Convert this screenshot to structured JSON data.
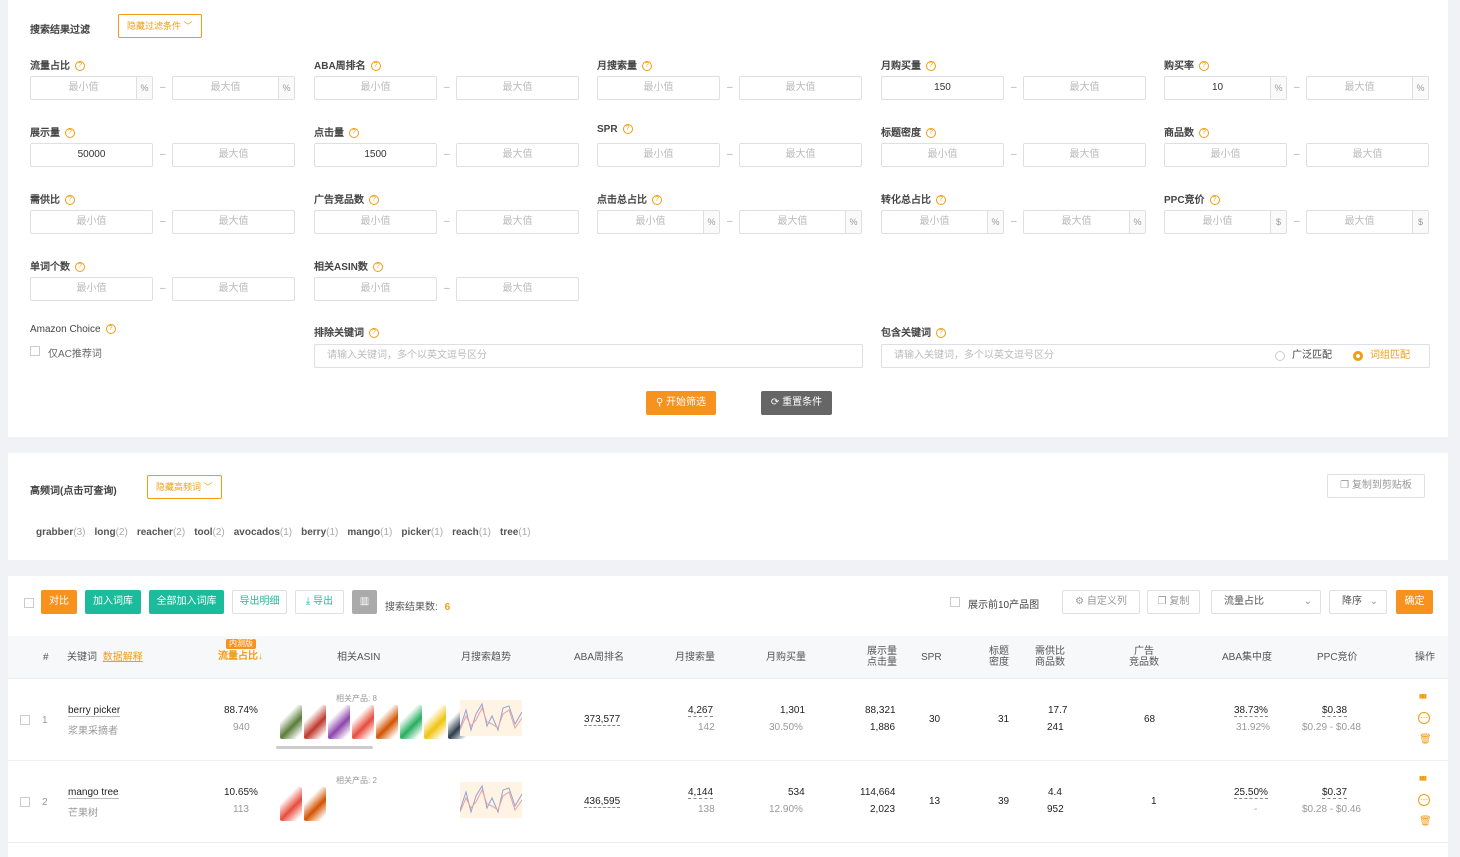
{
  "filter": {
    "title": "搜索结果过滤",
    "hide_btn": "隐藏过滤条件 ﹀",
    "min": "最小值",
    "max": "最大值",
    "fields": [
      {
        "label": "流量占比",
        "min": "",
        "max": "",
        "unit": "%"
      },
      {
        "label": "ABA周排名",
        "min": "",
        "max": "",
        "unit": ""
      },
      {
        "label": "月搜索量",
        "min": "",
        "max": "",
        "unit": ""
      },
      {
        "label": "月购买量",
        "min": "150",
        "max": "",
        "unit": ""
      },
      {
        "label": "购买率",
        "min": "10",
        "max": "",
        "unit": "%"
      },
      {
        "label": "展示量",
        "min": "50000",
        "max": "",
        "unit": ""
      },
      {
        "label": "点击量",
        "min": "1500",
        "max": "",
        "unit": ""
      },
      {
        "label": "SPR",
        "min": "",
        "max": "",
        "unit": ""
      },
      {
        "label": "标题密度",
        "min": "",
        "max": "",
        "unit": ""
      },
      {
        "label": "商品数",
        "min": "",
        "max": "",
        "unit": ""
      },
      {
        "label": "需供比",
        "min": "",
        "max": "",
        "unit": ""
      },
      {
        "label": "广告竞品数",
        "min": "",
        "max": "",
        "unit": ""
      },
      {
        "label": "点击总占比",
        "min": "",
        "max": "",
        "unit": "%"
      },
      {
        "label": "转化总占比",
        "min": "",
        "max": "",
        "unit": "%"
      },
      {
        "label": "PPC竞价",
        "min": "",
        "max": "",
        "unit": "$"
      },
      {
        "label": "单词个数",
        "min": "",
        "max": "",
        "unit": ""
      },
      {
        "label": "相关ASIN数",
        "min": "",
        "max": "",
        "unit": ""
      }
    ],
    "amazon_choice": "Amazon Choice",
    "ac_only": "仅AC推荐词",
    "exclude_label": "排除关键词",
    "exclude_placeholder": "请输入关键词，多个以英文逗号区分",
    "include_label": "包含关键词",
    "include_placeholder": "请输入关键词，多个以英文逗号区分",
    "broad_match": "广泛匹配",
    "phrase_match": "词组匹配",
    "start_btn": "开始筛选",
    "reset_btn": "重置条件"
  },
  "hf": {
    "title": "高频词(点击可查询)",
    "hide_btn": "隐藏高频词 ﹀",
    "copy_btn": "复制到剪贴板",
    "words": [
      {
        "w": "grabber",
        "n": "(3)"
      },
      {
        "w": "long",
        "n": "(2)"
      },
      {
        "w": "reacher",
        "n": "(2)"
      },
      {
        "w": "tool",
        "n": "(2)"
      },
      {
        "w": "avocados",
        "n": "(1)"
      },
      {
        "w": "berry",
        "n": "(1)"
      },
      {
        "w": "mango",
        "n": "(1)"
      },
      {
        "w": "picker",
        "n": "(1)"
      },
      {
        "w": "reach",
        "n": "(1)"
      },
      {
        "w": "tree",
        "n": "(1)"
      }
    ]
  },
  "toolbar": {
    "compare": "对比",
    "add_lib": "加入词库",
    "add_all": "全部加入词库",
    "export_detail": "导出明细",
    "export": "导出",
    "result_label": "搜索结果数:",
    "result_count": "6",
    "show_top10": "展示前10产品图",
    "custom_cols": "自定义列",
    "copy": "复制",
    "sort_field": "流量占比",
    "sort_order": "降序",
    "confirm": "确定"
  },
  "table": {
    "headers": {
      "idx": "#",
      "kw": "关键词",
      "kw_link": "数据解释",
      "badge": "内测版",
      "traffic": "流量占比↓",
      "asin": "相关ASIN",
      "trend": "月搜索趋势",
      "aba": "ABA周排名",
      "search": "月搜索量",
      "buy": "月购买量",
      "impr1": "展示量",
      "impr2": "点击量",
      "spr": "SPR",
      "title1": "标题",
      "title2": "密度",
      "ds1": "需供比",
      "ds2": "商品数",
      "ad1": "广告",
      "ad2": "竞品数",
      "abac": "ABA集中度",
      "ppc": "PPC竞价",
      "op": "操作"
    },
    "rows": [
      {
        "idx": "1",
        "kw": "berry picker",
        "kw_cn": "浆果采摘者",
        "traffic": "88.74%",
        "traffic_sub": "940",
        "asin_label": "相关产品: 8",
        "aba": "373,577",
        "search": "4,267",
        "search_sub": "142",
        "buy": "1,301",
        "buy_sub": "30.50%",
        "impr": "88,321",
        "clicks": "1,886",
        "spr": "30",
        "title": "31",
        "ds": "17.7",
        "goods": "241",
        "ad": "68",
        "abac": "38.73%",
        "abac_sub": "31.92%",
        "ppc": "$0.38",
        "ppc_range": "$0.29 - $0.48"
      },
      {
        "idx": "2",
        "kw": "mango tree",
        "kw_cn": "芒果树",
        "traffic": "10.65%",
        "traffic_sub": "113",
        "asin_label": "相关产品: 2",
        "aba": "436,595",
        "search": "4,144",
        "search_sub": "138",
        "buy": "534",
        "buy_sub": "12.90%",
        "impr": "114,664",
        "clicks": "2,023",
        "spr": "13",
        "title": "39",
        "ds": "4.4",
        "goods": "952",
        "ad": "1",
        "abac": "25.50%",
        "abac_sub": "-",
        "ppc": "$0.37",
        "ppc_range": "$0.28 - $0.46"
      }
    ]
  },
  "colors": {
    "accent": "#f7921e",
    "green": "#1abc9c"
  }
}
